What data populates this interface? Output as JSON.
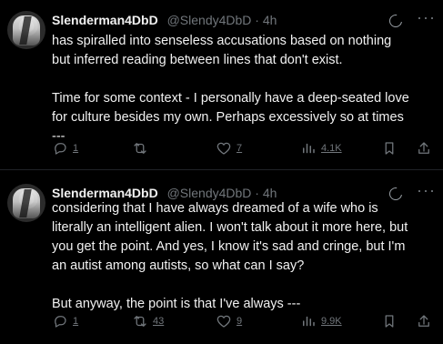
{
  "tweets": [
    {
      "author": "Slenderman4DbD",
      "handle": "@Slendy4DbD",
      "separator": "·",
      "time": "4h",
      "text": "has spiralled into senseless accusations based on nothing\nbut inferred reading between lines that don't exist.\n\nTime for some context - I personally have a deep-seated love\nfor culture besides my own. Perhaps excessively so at times\n---",
      "stats": {
        "replies": "1",
        "retweets": "",
        "likes": "7",
        "views": "4.1K"
      }
    },
    {
      "author": "Slenderman4DbD",
      "handle": "@Slendy4DbD",
      "separator": "·",
      "time": "4h",
      "text": "considering that I have always dreamed of a wife who is\nliterally an intelligent alien. I won't talk about it more here, but\nyou get the point. And yes, I know it's sad and cringe, but I'm\nan autist among autists, so what can I say?\n\nBut anyway, the point is that I've always ---",
      "stats": {
        "replies": "1",
        "retweets": "43",
        "likes": "9",
        "views": "9.9K"
      }
    }
  ],
  "icons": {
    "reply": "reply-icon",
    "retweet": "retweet-icon",
    "like": "heart-icon",
    "views": "views-icon",
    "bookmark": "bookmark-icon",
    "share": "share-icon",
    "grok": "grok-icon",
    "more": "more-icon"
  }
}
